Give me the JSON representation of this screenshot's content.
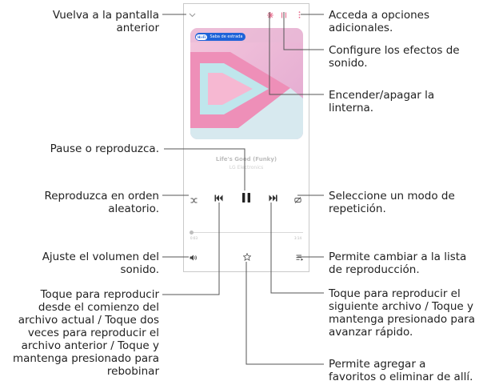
{
  "player": {
    "badge_hd": "Hi-Fi",
    "badge_text": "Saba de estrada",
    "song_title": "Life's Good (Funky)",
    "song_artist": "LG Electronics",
    "time_elapsed": "0:03",
    "time_total": "3:14",
    "icons": {
      "back": "chevron-down-icon",
      "flashlight": "flashlight-icon",
      "sound_effects": "equalizer-icon",
      "more": "more-vert-icon",
      "shuffle": "shuffle-icon",
      "previous": "skip-previous-icon",
      "play_pause": "pause-icon",
      "next": "skip-next-icon",
      "repeat": "repeat-icon",
      "volume": "volume-icon",
      "favorite": "star-icon",
      "playlist": "playlist-icon"
    }
  },
  "callouts": {
    "back": [
      "Vuelva a la pantalla",
      "anterior"
    ],
    "more_options": [
      "Acceda a opciones",
      "adicionales."
    ],
    "sound_effects": [
      "Configure los efectos de",
      "sonido."
    ],
    "flashlight": [
      "Encender/apagar la",
      "linterna."
    ],
    "pause_play": [
      "Pause o reproduzca."
    ],
    "shuffle": [
      "Reproduzca en orden",
      "aleatorio."
    ],
    "repeat": [
      "Seleccione un modo de",
      "repetición."
    ],
    "volume": [
      "Ajuste el volumen del",
      "sonido."
    ],
    "playlist": [
      "Permite cambiar a la lista",
      "de reproducción."
    ],
    "previous": [
      "Toque para reproducir",
      "desde el comienzo del",
      "archivo actual / Toque dos",
      "veces para reproducir el",
      "archivo anterior / Toque y",
      "mantenga presionado para",
      "rebobinar"
    ],
    "next": [
      "Toque para reproducir el",
      "siguiente archivo / Toque y",
      "mantenga presionado para",
      "avanzar rápido."
    ],
    "favorites": [
      "Permite agregar a",
      "favoritos o eliminar de allí."
    ]
  }
}
